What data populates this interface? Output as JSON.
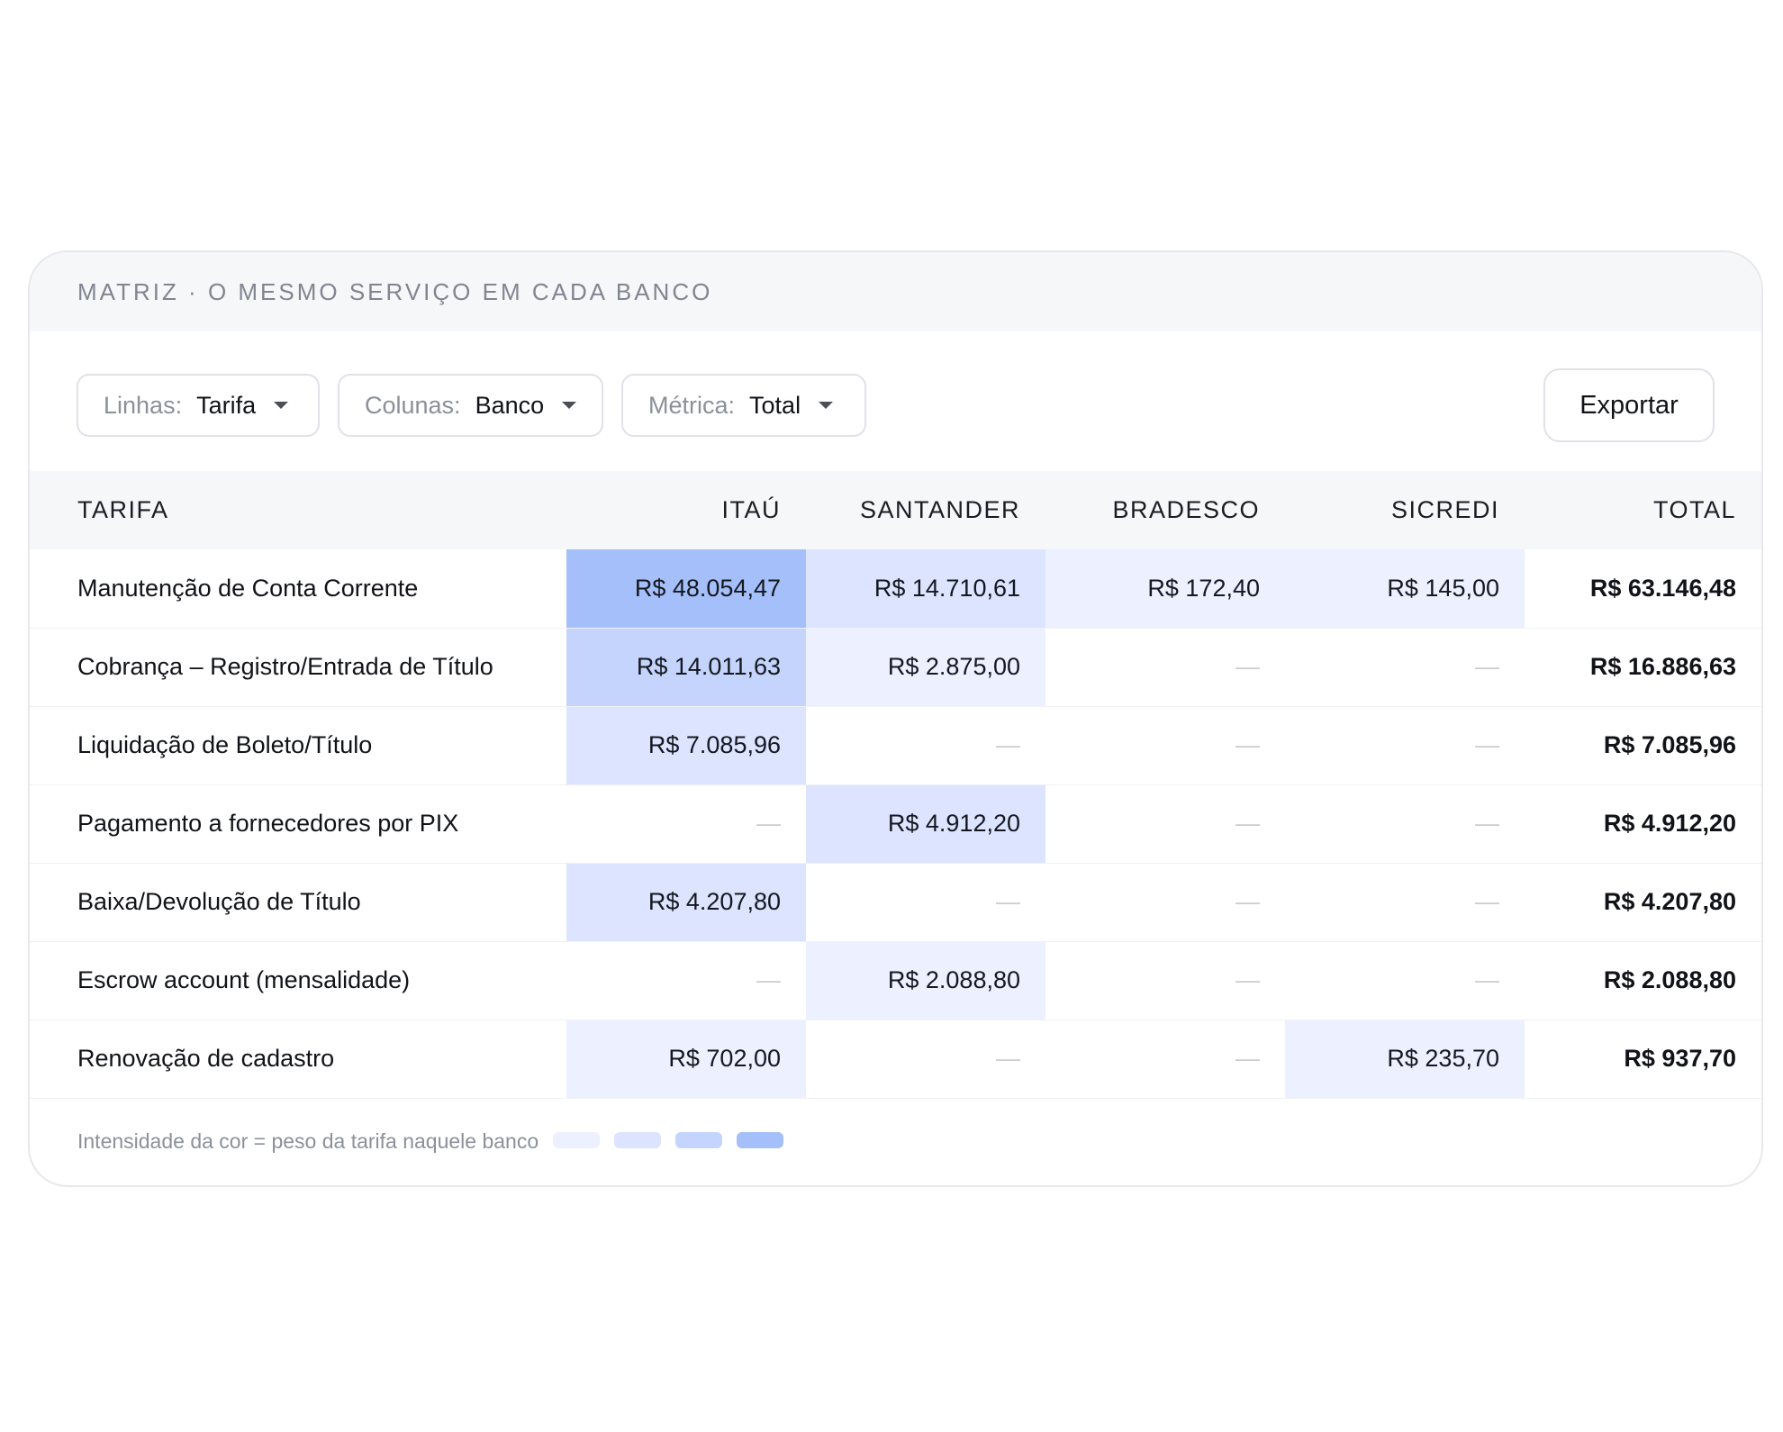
{
  "header": {
    "title": "MATRIZ · O MESMO SERVIÇO EM CADA BANCO"
  },
  "controls": {
    "rows": {
      "label": "Linhas:",
      "value": "Tarifa"
    },
    "columns": {
      "label": "Colunas:",
      "value": "Banco"
    },
    "metric": {
      "label": "Métrica:",
      "value": "Total"
    },
    "export_label": "Exportar"
  },
  "table": {
    "headers": [
      "TARIFA",
      "ITAÚ",
      "SANTANDER",
      "BRADESCO",
      "SICREDI",
      "TOTAL"
    ],
    "rows": [
      {
        "tarifa": "Manutenção de Conta Corrente",
        "cells": [
          "R$ 48.054,47",
          "R$ 14.710,61",
          "R$ 172,40",
          "R$ 145,00"
        ],
        "levels": [
          4,
          2,
          1,
          1
        ],
        "total": "R$ 63.146,48"
      },
      {
        "tarifa": "Cobrança – Registro/Entrada de Título",
        "cells": [
          "R$ 14.011,63",
          "R$ 2.875,00",
          "—",
          "—"
        ],
        "levels": [
          3,
          1,
          0,
          0
        ],
        "total": "R$ 16.886,63"
      },
      {
        "tarifa": "Liquidação de Boleto/Título",
        "cells": [
          "R$ 7.085,96",
          "—",
          "—",
          "—"
        ],
        "levels": [
          2,
          0,
          0,
          0
        ],
        "total": "R$ 7.085,96"
      },
      {
        "tarifa": "Pagamento a fornecedores por PIX",
        "cells": [
          "—",
          "R$ 4.912,20",
          "—",
          "—"
        ],
        "levels": [
          0,
          2,
          0,
          0
        ],
        "total": "R$ 4.912,20"
      },
      {
        "tarifa": "Baixa/Devolução de Título",
        "cells": [
          "R$ 4.207,80",
          "—",
          "—",
          "—"
        ],
        "levels": [
          2,
          0,
          0,
          0
        ],
        "total": "R$ 4.207,80"
      },
      {
        "tarifa": "Escrow account (mensalidade)",
        "cells": [
          "—",
          "R$ 2.088,80",
          "—",
          "—"
        ],
        "levels": [
          0,
          1,
          0,
          0
        ],
        "total": "R$ 2.088,80"
      },
      {
        "tarifa": "Renovação de cadastro",
        "cells": [
          "R$ 702,00",
          "—",
          "—",
          "R$ 235,70"
        ],
        "levels": [
          1,
          0,
          0,
          1
        ],
        "total": "R$ 937,70"
      }
    ]
  },
  "legend": {
    "text": "Intensidade da cor = peso da tarifa naquele banco",
    "colors": [
      "#edf0ff",
      "#dde4ff",
      "#c4d4fd",
      "#a5bffa"
    ]
  }
}
